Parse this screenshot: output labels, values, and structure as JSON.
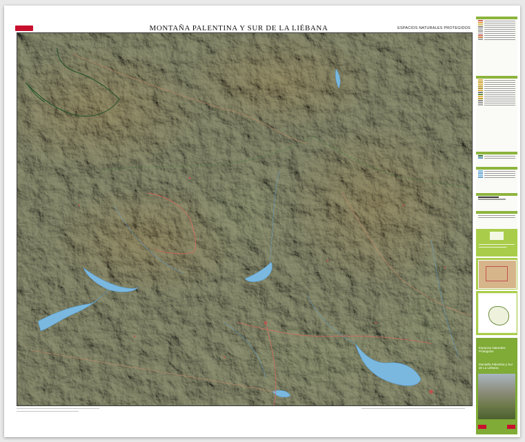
{
  "header": {
    "title": "MONTAÑA PALENTINA Y SUR DE LA LIÉBANA",
    "subtitle": "ESPACIOS NATURALES PROTEGIDOS"
  },
  "map": {
    "feature_colors": {
      "relief_base": "#8a8e6a",
      "high_ground": "#a8875a",
      "water": "#7ab8e0",
      "roads": "#d06060",
      "protected_boundary": "#2f6b2f",
      "settlements": "#c0504d"
    },
    "water_bodies": [
      "reservoir",
      "reservoir",
      "reservoir",
      "reservoir"
    ]
  },
  "sidebar": {
    "cover": {
      "series_name": "Espacios Naturales Protegidos",
      "map_name": "Montaña Palentina y Sur de La Liébana"
    },
    "accent_color": "#8cb43c"
  },
  "icons": [
    "map-sheet-logo",
    "cover-photo"
  ]
}
